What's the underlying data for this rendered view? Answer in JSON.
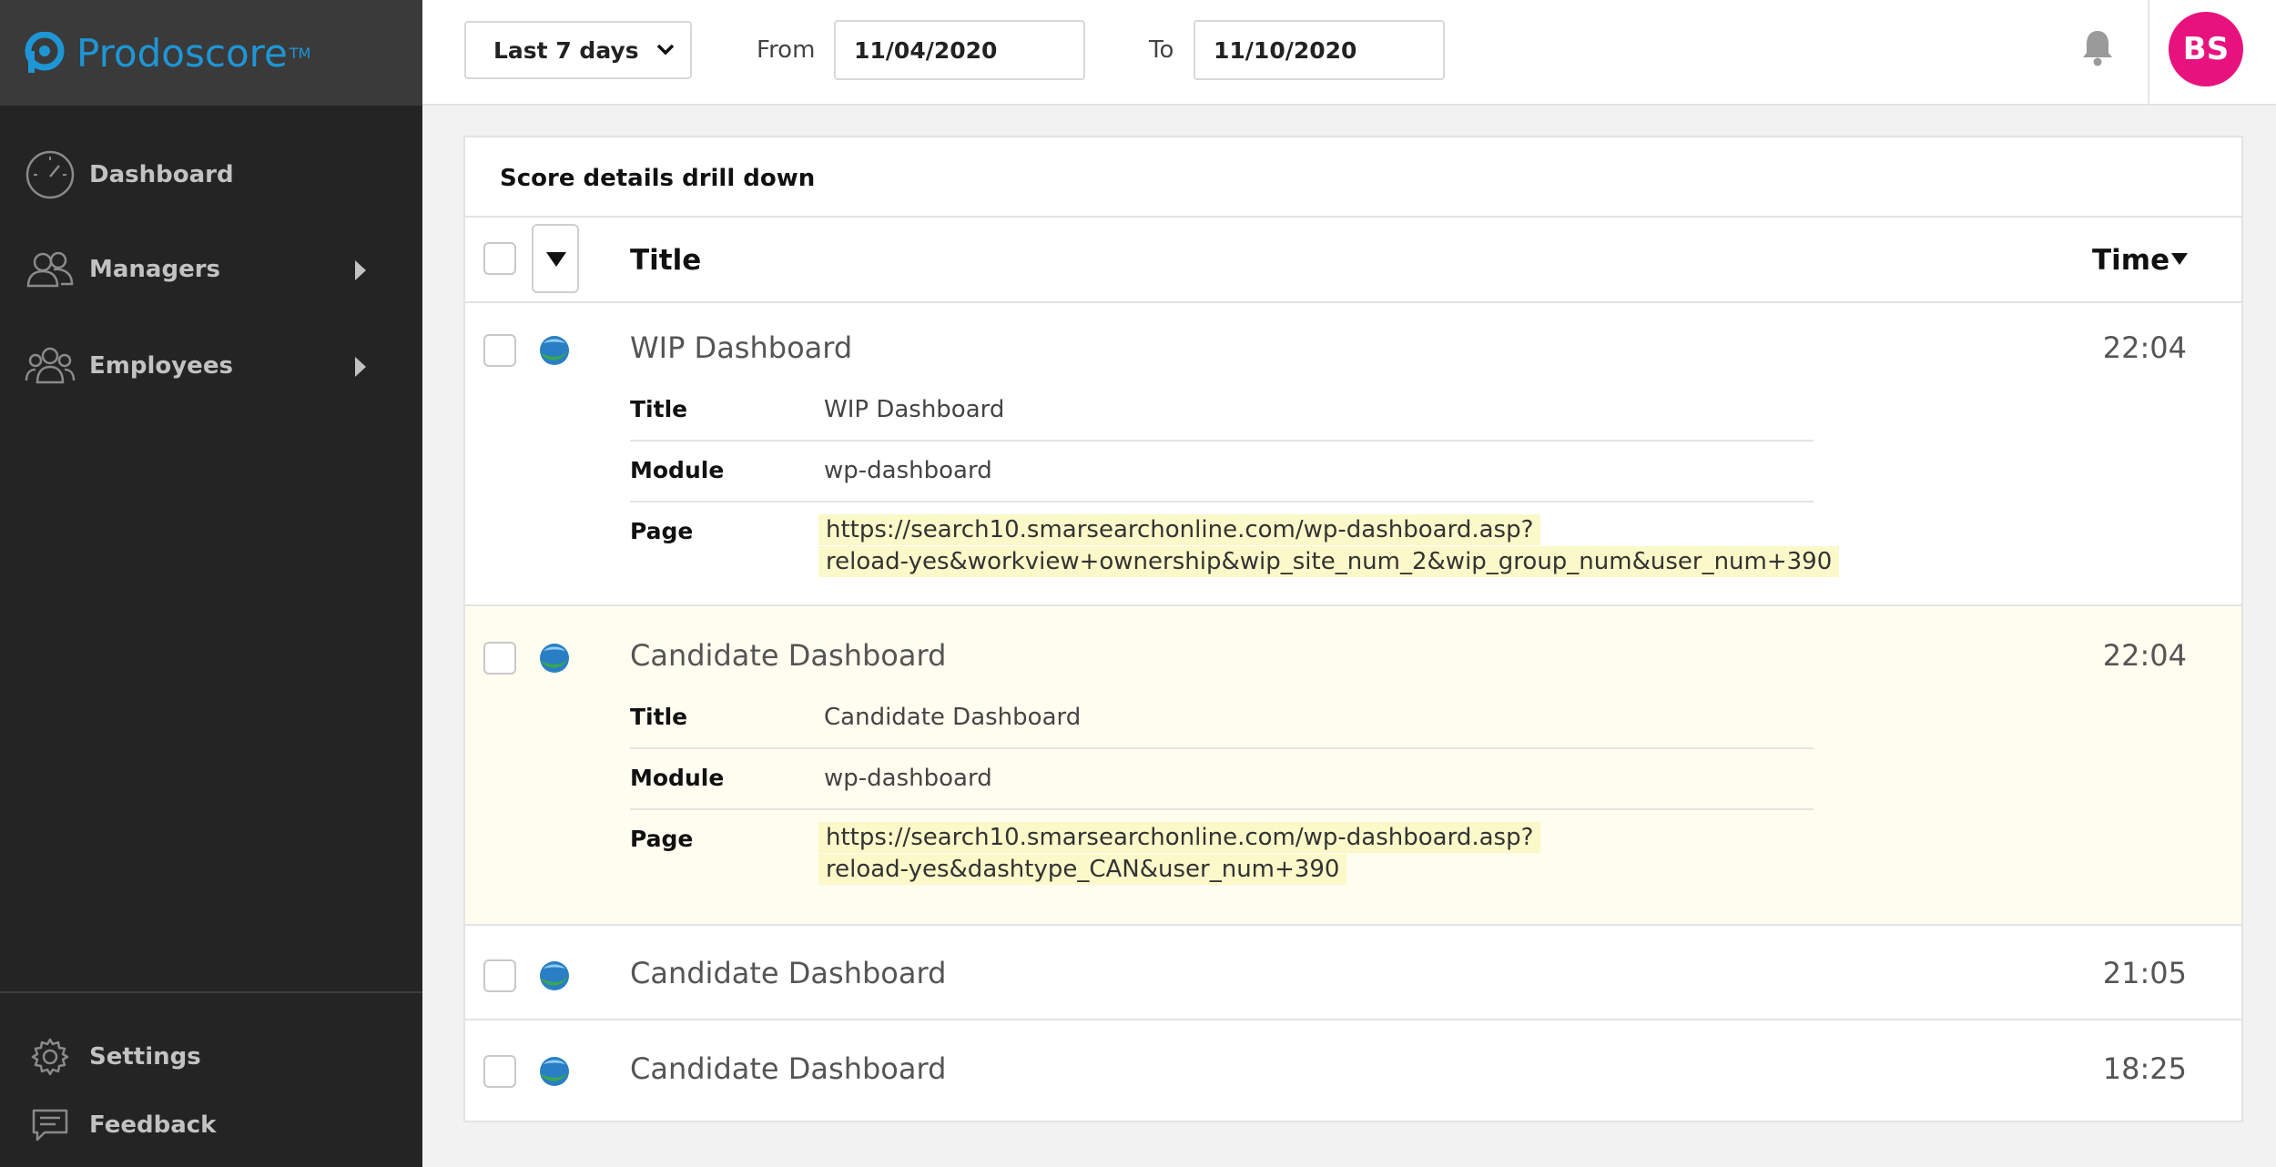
{
  "brand": {
    "name": "Prodoscore",
    "tm": "TM"
  },
  "sidebar": {
    "items": [
      {
        "label": "Dashboard",
        "icon": "speedometer-icon"
      },
      {
        "label": "Managers",
        "icon": "managers-icon"
      },
      {
        "label": "Employees",
        "icon": "employees-icon"
      }
    ],
    "footer": [
      {
        "label": "Settings",
        "icon": "gear-icon"
      },
      {
        "label": "Feedback",
        "icon": "chat-icon"
      }
    ]
  },
  "toolbar": {
    "range_label": "Last 7 days",
    "from_label": "From",
    "from_value": "11/04/2020",
    "to_label": "To",
    "to_value": "11/10/2020",
    "avatar_initials": "BS"
  },
  "card": {
    "title": "Score details drill down",
    "col_title": "Title",
    "col_time": "Time"
  },
  "rows": [
    {
      "title": "WIP Dashboard",
      "time": "22:04",
      "details": {
        "title_label": "Title",
        "title_value": "WIP Dashboard",
        "module_label": "Module",
        "module_value": "wp-dashboard",
        "page_label": "Page",
        "page_line1": "https://search10.smarsearchonline.com/wp-dashboard.asp?",
        "page_line2": "reload-yes&workview+ownership&wip_site_num_2&wip_group_num&user_num+390"
      }
    },
    {
      "title": "Candidate Dashboard",
      "time": "22:04",
      "details": {
        "title_label": "Title",
        "title_value": "Candidate Dashboard",
        "module_label": "Module",
        "module_value": "wp-dashboard",
        "page_label": "Page",
        "page_line1": "https://search10.smarsearchonline.com/wp-dashboard.asp?",
        "page_line2": "reload-yes&dashtype_CAN&user_num+390"
      }
    },
    {
      "title": "Candidate Dashboard",
      "time": "21:05"
    },
    {
      "title": "Candidate Dashboard",
      "time": "18:25"
    }
  ],
  "colors": {
    "sidebar_bg": "#242424",
    "logo_bar_bg": "#3a3a3a",
    "brand_blue": "#1e96d6",
    "avatar_pink": "#e8127f",
    "highlight_row": "#fffdf0",
    "url_highlight": "#fbf8c9"
  }
}
